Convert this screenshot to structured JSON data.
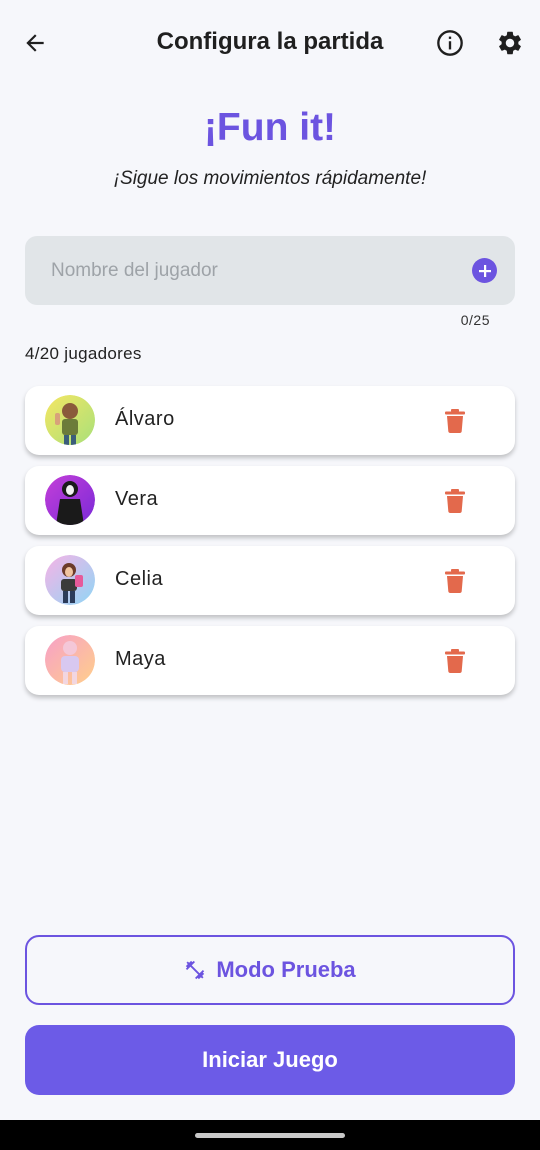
{
  "appbar": {
    "title": "Configura la partida",
    "back_icon": "arrow-left-icon",
    "info_icon": "info-icon",
    "settings_icon": "gear-icon"
  },
  "brand": {
    "title": "¡Fun it!",
    "subtitle": "¡Sigue los movimientos rápidamente!"
  },
  "player_input": {
    "value": "",
    "placeholder": "Nombre del jugador",
    "counter": "0/25",
    "add_icon": "plus-circle-icon"
  },
  "players_count": "4/20 jugadores",
  "players": [
    {
      "name": "Álvaro",
      "avatar_bg": [
        "#f5e663",
        "#a8e07a"
      ]
    },
    {
      "name": "Vera",
      "avatar_bg": [
        "#c43fd8",
        "#7a2ad8"
      ]
    },
    {
      "name": "Celia",
      "avatar_bg": [
        "#f7b3e6",
        "#8fd6f5"
      ]
    },
    {
      "name": "Maya",
      "avatar_bg": [
        "#f7a0c8",
        "#ffcf8a"
      ]
    }
  ],
  "actions": {
    "test_mode_label": "Modo Prueba",
    "test_mode_icon": "dumbbell-icon",
    "start_label": "Iniciar Juego"
  },
  "colors": {
    "accent": "#6c54e0",
    "delete": "#e3694c",
    "background": "#f6f7fb"
  }
}
